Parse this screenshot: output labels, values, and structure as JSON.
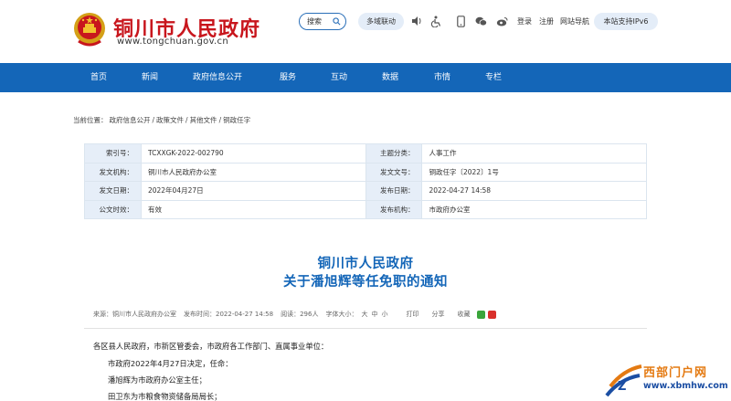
{
  "header": {
    "site_title": "铜川市人民政府",
    "site_url": "www.tongchuan.gov.cn",
    "search_label": "搜索",
    "pill_multi_domain": "多域联动",
    "login": "登录",
    "register": "注册",
    "site_nav": "网站导航",
    "ipv6": "本站支持IPv6",
    "icons": [
      "sound-icon",
      "accessibility-icon",
      "mobile-icon",
      "wechat-icon",
      "weibo-icon"
    ]
  },
  "nav": {
    "items": [
      "首页",
      "新闻",
      "政府信息公开",
      "服务",
      "互动",
      "数据",
      "市情",
      "专栏"
    ]
  },
  "breadcrumb": {
    "prefix": "当前位置：",
    "items": [
      "政府信息公开",
      "政策文件",
      "其他文件",
      "铜政任字"
    ]
  },
  "meta": {
    "rows": [
      {
        "l1": "索引号：",
        "v1": "TCXXGK-2022-002790",
        "l2": "主题分类：",
        "v2": "人事工作"
      },
      {
        "l1": "发文机构：",
        "v1": "铜川市人民政府办公室",
        "l2": "发文文号：",
        "v2": "铜政任字〔2022〕1号"
      },
      {
        "l1": "发文日期：",
        "v1": "2022年04月27日",
        "l2": "发布日期：",
        "v2": "2022-04-27 14:58"
      },
      {
        "l1": "公文时效：",
        "v1": "有效",
        "l2": "发布机构：",
        "v2": "市政府办公室"
      }
    ]
  },
  "article": {
    "title_line1": "铜川市人民政府",
    "title_line2": "关于潘旭辉等任免职的通知",
    "source": "来源：",
    "source_value": "铜川市人民政府办公室",
    "publish_time": "发布时间：",
    "publish_time_value": "2022-04-27 14:58",
    "views": "阅读：",
    "views_value": "296人",
    "font_size": "字体大小：",
    "size_large": "大",
    "size_medium": "中",
    "size_small": "小",
    "print": "打印",
    "share": "分享",
    "favorite": "收藏",
    "body": [
      "各区县人民政府，市新区管委会，市政府各工作部门、直属事业单位：",
      "市政府2022年4月27日决定，任命：",
      "潘旭辉为市政府办公室主任；",
      "田卫东为市粮食物资储备局局长；"
    ]
  },
  "watermark": {
    "name": "西部门户网",
    "url": "www.xbmhw.com"
  },
  "colors": {
    "brand_red": "#c8161d",
    "nav_blue": "#1466b8",
    "title_blue": "#1466b8",
    "label_bg": "#e6eef8",
    "valid_green": "#1b8c33",
    "watermark_orange": "#e47a12"
  }
}
